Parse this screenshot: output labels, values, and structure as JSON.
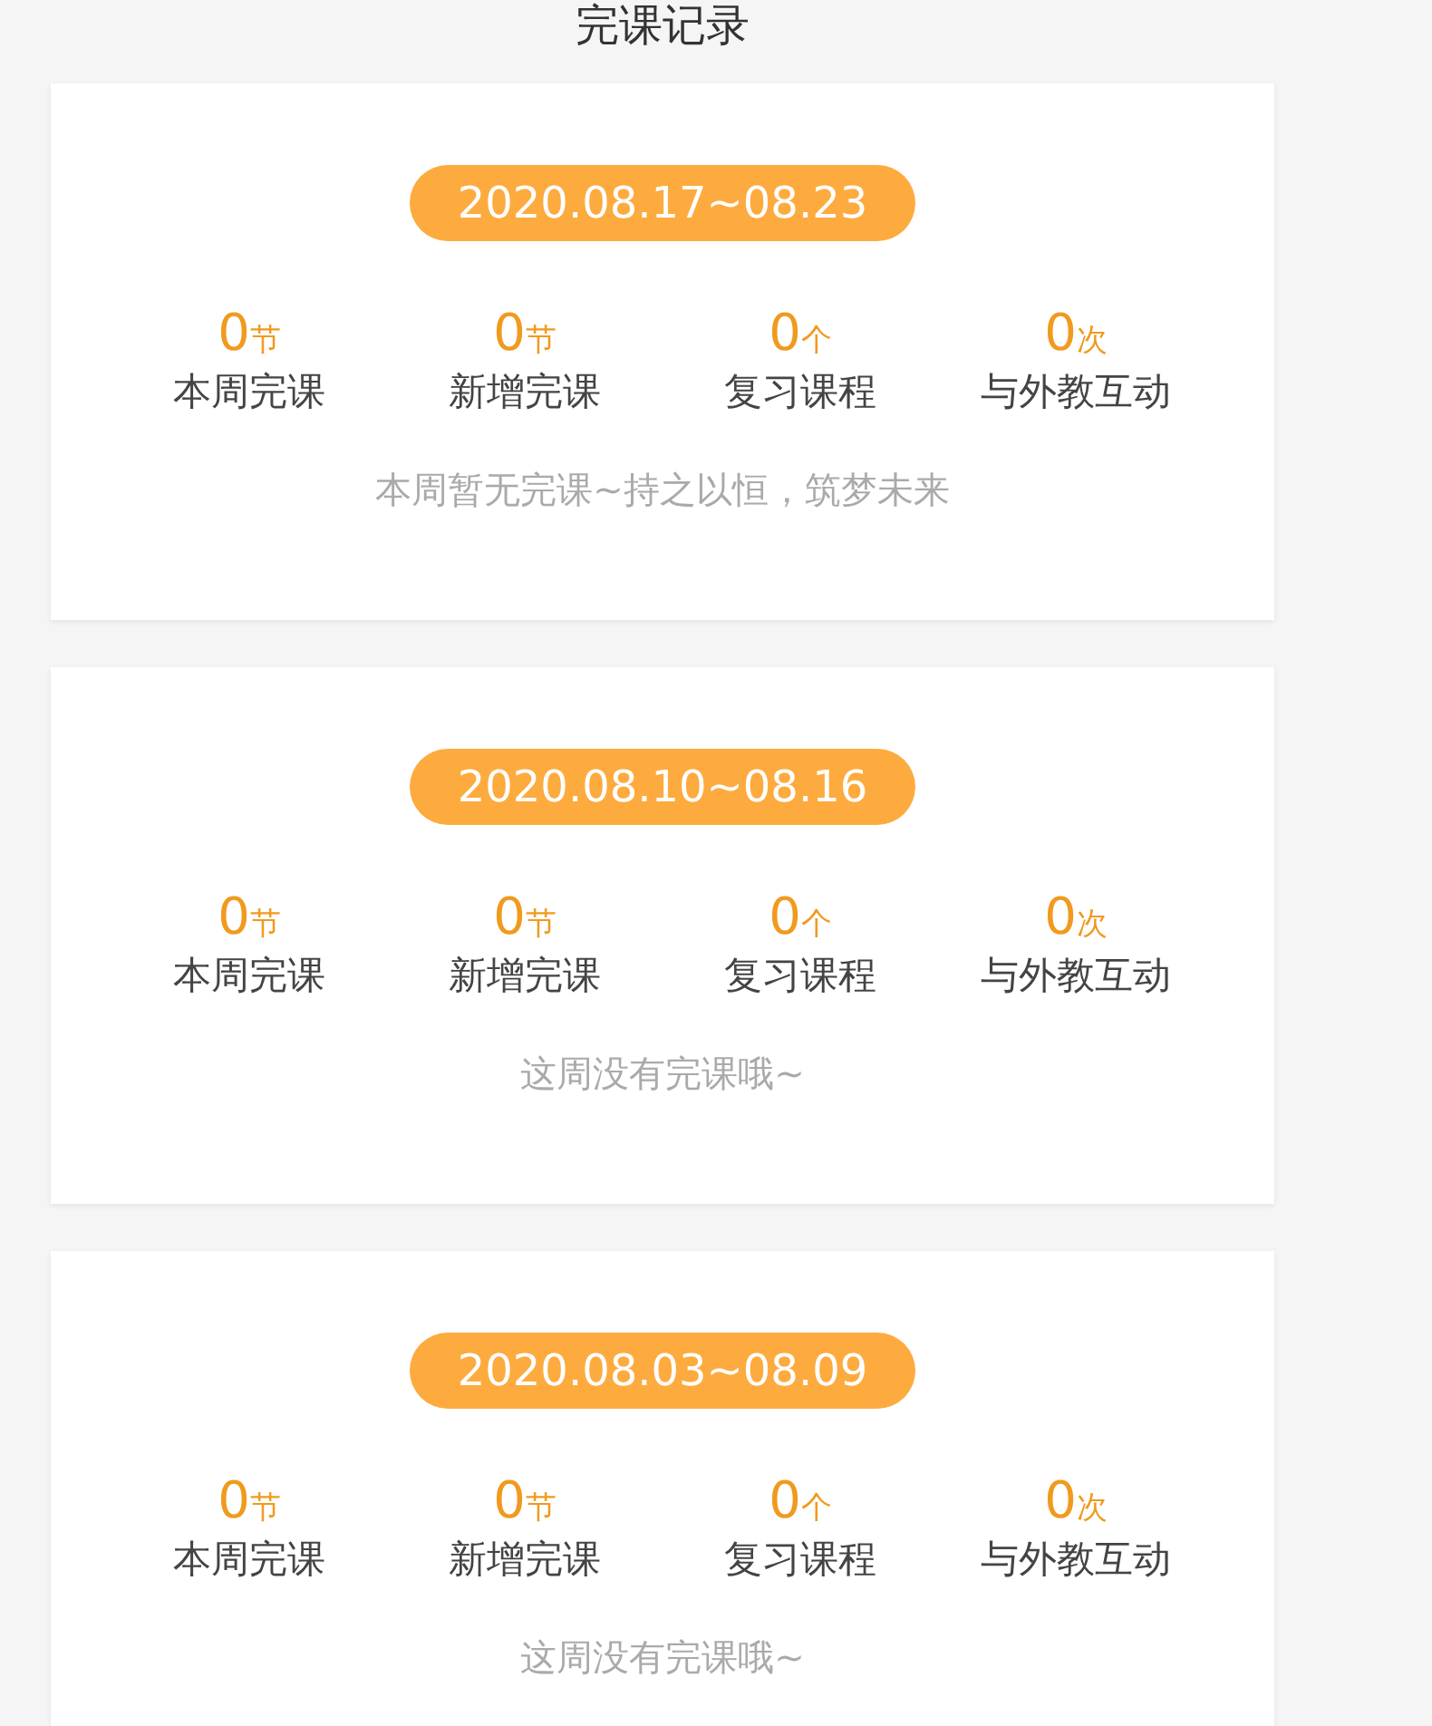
{
  "title": "完课记录",
  "weeks": [
    {
      "date_range": "2020.08.17~08.23",
      "stats": [
        {
          "value": "0",
          "unit": "节",
          "label": "本周完课"
        },
        {
          "value": "0",
          "unit": "节",
          "label": "新增完课"
        },
        {
          "value": "0",
          "unit": "个",
          "label": "复习课程"
        },
        {
          "value": "0",
          "unit": "次",
          "label": "与外教互动"
        }
      ],
      "message": "本周暂无完课~持之以恒，筑梦未来"
    },
    {
      "date_range": "2020.08.10~08.16",
      "stats": [
        {
          "value": "0",
          "unit": "节",
          "label": "本周完课"
        },
        {
          "value": "0",
          "unit": "节",
          "label": "新增完课"
        },
        {
          "value": "0",
          "unit": "个",
          "label": "复习课程"
        },
        {
          "value": "0",
          "unit": "次",
          "label": "与外教互动"
        }
      ],
      "message": "这周没有完课哦~"
    },
    {
      "date_range": "2020.08.03~08.09",
      "stats": [
        {
          "value": "0",
          "unit": "节",
          "label": "本周完课"
        },
        {
          "value": "0",
          "unit": "节",
          "label": "新增完课"
        },
        {
          "value": "0",
          "unit": "个",
          "label": "复习课程"
        },
        {
          "value": "0",
          "unit": "次",
          "label": "与外教互动"
        }
      ],
      "message": "这周没有完课哦~"
    }
  ]
}
